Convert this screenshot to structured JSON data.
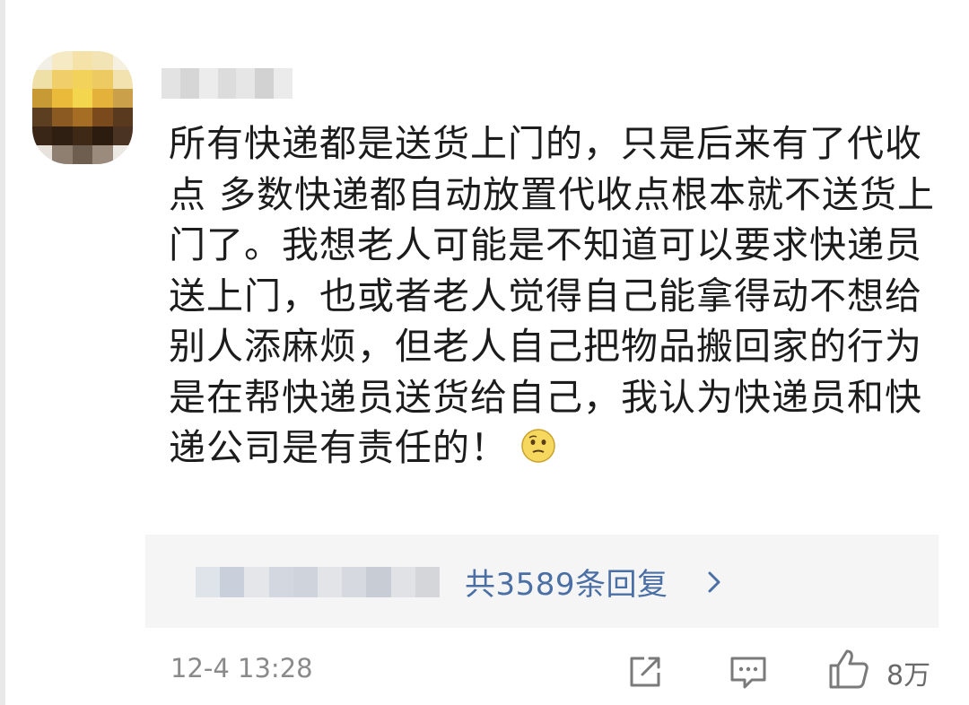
{
  "colors": {
    "text": "#1c1c1c",
    "link": "#4a6fa5",
    "muted": "#8a8a8a",
    "reply_background": "#f6f5f5"
  },
  "comment": {
    "author": "",
    "text": "所有快递都是送货上门的，只是后来有了代收点 多数快递都自动放置代收点根本就不送货上门了。我想老人可能是不知道可以要求快递员送上门，也或者老人觉得自己能拿得动不想给别人添麻烦，但老人自己把物品搬回家的行为是在帮快递员送货给自己，我认为快递员和快递公司是有责任的！",
    "emoji": "thinking-face-icon",
    "replies_label": "共3589条回复",
    "timestamp": "12-4 13:28",
    "like_count": "8万"
  },
  "icons": {
    "share": "share-icon",
    "reply": "comment-icon",
    "like": "thumbs-up-icon",
    "more": "chevron-right-icon"
  }
}
